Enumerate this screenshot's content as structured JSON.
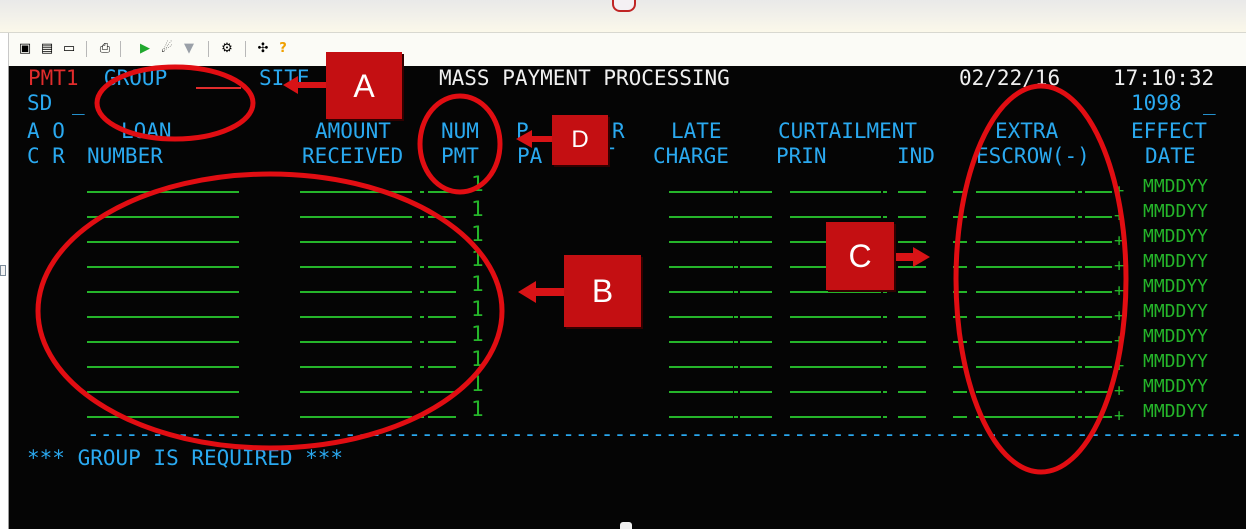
{
  "screen": {
    "code": "PMT1",
    "group_label": "GROUP",
    "site_label": "SITE",
    "title": "MASS PAYMENT PROCESSING",
    "date": "02/22/16",
    "time": "17:10:32",
    "sd_label": "SD",
    "form_code": "1098",
    "cursor": "_"
  },
  "headers": {
    "row1": {
      "ac": "A O",
      "loan": "LOAN",
      "amount": "AMOUNT",
      "num": "NUM",
      "pmt_partial": "P",
      "pmt_partial_right": "R",
      "late": "LATE",
      "curtailment": "CURTAILMENT",
      "extra": "EXTRA",
      "effect": "EFFECT"
    },
    "row2": {
      "cr": "C R",
      "number": "NUMBER",
      "received": "RECEIVED",
      "pmt": "PMT",
      "pa": "PA",
      "pa_right": "T",
      "charge": "CHARGE",
      "prin": "PRIN",
      "ind": "IND",
      "escrow": "ESCROW(-)",
      "date": "DATE"
    }
  },
  "rows": [
    {
      "num_pmt": "1",
      "sign": "+",
      "effect_date": "MMDDYY"
    },
    {
      "num_pmt": "1",
      "sign": "+",
      "effect_date": "MMDDYY"
    },
    {
      "num_pmt": "1",
      "sign": "+",
      "effect_date": "MMDDYY"
    },
    {
      "num_pmt": "1",
      "sign": "+",
      "effect_date": "MMDDYY"
    },
    {
      "num_pmt": "1",
      "sign": "+",
      "effect_date": "MMDDYY"
    },
    {
      "num_pmt": "1",
      "sign": "+",
      "effect_date": "MMDDYY"
    },
    {
      "num_pmt": "1",
      "sign": "+",
      "effect_date": "MMDDYY"
    },
    {
      "num_pmt": "1",
      "sign": "+",
      "effect_date": "MMDDYY"
    },
    {
      "num_pmt": "1",
      "sign": "+",
      "effect_date": "MMDDYY"
    },
    {
      "num_pmt": "1",
      "sign": "+",
      "effect_date": "MMDDYY"
    }
  ],
  "message": "*** GROUP IS REQUIRED ***",
  "callouts": [
    "A",
    "B",
    "C",
    "D"
  ],
  "toolbar_icons": [
    "copy-icon",
    "paste-icon",
    "screen-icon",
    "print-icon",
    "play-icon",
    "macro-icon",
    "dropdown-icon",
    "tools-icon",
    "settings-icon",
    "help-icon"
  ],
  "colors": {
    "terminal_background": "#050505",
    "header_text": "#2aa9f0",
    "screen_code": "#e12c2c",
    "field_text": "#25b52a",
    "annotation": "#c40f12"
  }
}
